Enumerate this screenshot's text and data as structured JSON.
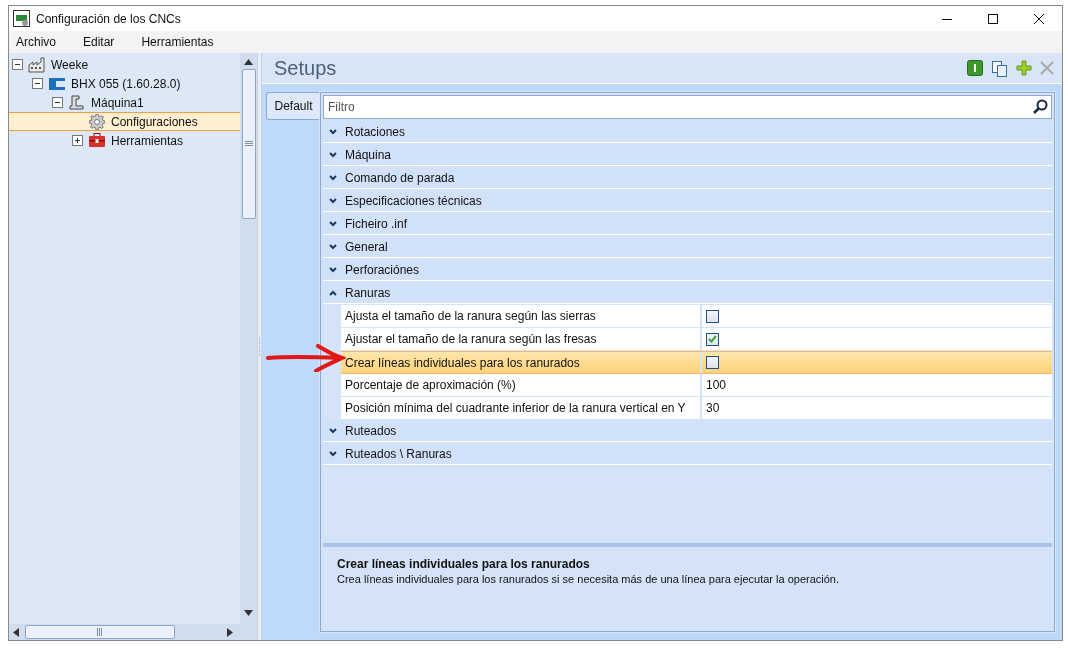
{
  "window": {
    "title": "Configuración de los CNCs"
  },
  "menu": [
    "Archivo",
    "Editar",
    "Herramientas"
  ],
  "tree": [
    {
      "label": "Weeke",
      "kind": "factory",
      "expanded": true,
      "selected": false,
      "children": [
        {
          "label": "BHX 055 (1.60.28.0)",
          "kind": "machine-series",
          "expanded": true,
          "selected": false,
          "children": [
            {
              "label": "Máquina1",
              "kind": "machine",
              "expanded": true,
              "selected": false,
              "children": [
                {
                  "label": "Configuraciones",
                  "kind": "settings",
                  "selected": true
                },
                {
                  "label": "Herramientas",
                  "kind": "toolbox",
                  "expanded": false,
                  "selected": false
                }
              ]
            }
          ]
        }
      ]
    }
  ],
  "panel": {
    "title": "Setups"
  },
  "tabs": [
    {
      "label": "Default",
      "selected": true
    }
  ],
  "filter": {
    "placeholder": "Filtro"
  },
  "categories": [
    {
      "label": "Rotaciones",
      "expanded": false
    },
    {
      "label": "Máquina",
      "expanded": false
    },
    {
      "label": "Comando de parada",
      "expanded": false
    },
    {
      "label": "Especificaciones técnicas",
      "expanded": false
    },
    {
      "label": "Ficheiro .inf",
      "expanded": false
    },
    {
      "label": "General",
      "expanded": false
    },
    {
      "label": "Perforaciónes",
      "expanded": false
    },
    {
      "label": "Ranuras",
      "expanded": true,
      "properties": [
        {
          "label": "Ajusta el tamaño de la ranura según las sierras",
          "kind": "checkbox",
          "checked": false,
          "selected": false
        },
        {
          "label": "Ajustar el tamaño de la ranura según las fresas",
          "kind": "checkbox",
          "checked": true,
          "selected": false
        },
        {
          "label": "Crear líneas individuales para los ranurados",
          "kind": "checkbox",
          "checked": false,
          "selected": true
        },
        {
          "label": "Porcentaje de aproximación (%)",
          "kind": "text",
          "value": "100",
          "selected": false
        },
        {
          "label": "Posición mínima del cuadrante inferior de la ranura vertical en Y",
          "kind": "text",
          "value": "30",
          "selected": false
        }
      ]
    },
    {
      "label": "Ruteados",
      "expanded": false
    },
    {
      "label": "Ruteados \\ Ranuras",
      "expanded": false
    }
  ],
  "description": {
    "title": "Crear líneas individuales para los ranurados",
    "text": "Crea líneas individuales para los ranurados si se necesita más de una línea para ejecutar la operación."
  }
}
